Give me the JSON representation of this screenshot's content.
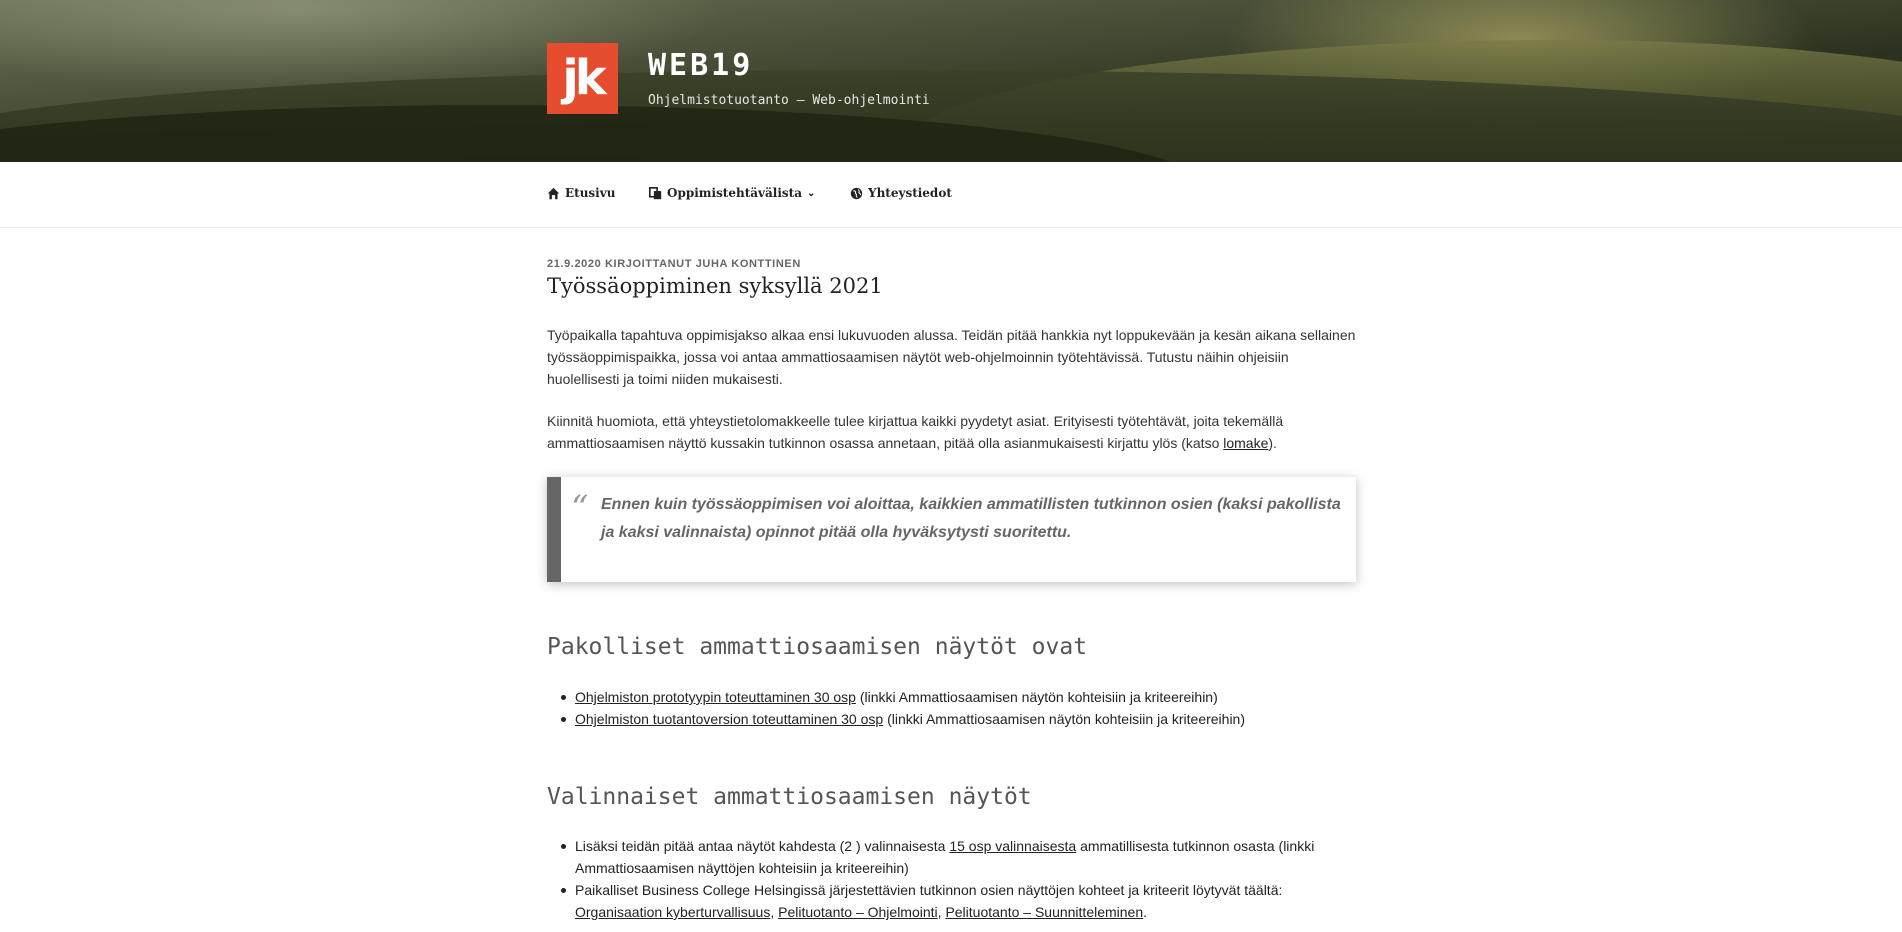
{
  "header": {
    "logo_text": "jk",
    "site_title": "WEB19",
    "site_description": "Ohjelmistotuotanto – Web-ohjelmointi"
  },
  "nav": {
    "items": [
      {
        "label": "Etusivu",
        "icon": "home-icon"
      },
      {
        "label": "Oppimistehtävälista",
        "icon": "copy-icon",
        "has_submenu": true
      },
      {
        "label": "Yhteystiedot",
        "icon": "globe-icon"
      }
    ]
  },
  "post": {
    "meta_date": "21.9.2020",
    "meta_by": "KIRJOITTANUT",
    "meta_author": "JUHA KONTTINEN",
    "title": "Työssäoppiminen syksyllä 2021",
    "para1": "Työpaikalla tapahtuva oppimisjakso alkaa ensi lukuvuoden alussa. Teidän pitää hankkia nyt loppukevään ja kesän aikana sellainen työssäoppimispaikka, jossa voi antaa ammattiosaamisen näytöt web-ohjelmoinnin työtehtävissä. Tutustu näihin ohjeisiin huolellisesti ja toimi niiden mukaisesti.",
    "para2_before": "Kiinnitä huomiota, että yhteystietolomakkeelle tulee kirjattua kaikki pyydetyt asiat. Erityisesti työtehtävät, joita tekemällä ammattiosaamisen näyttö kussakin tutkinnon osassa annetaan, pitää olla asianmukaisesti kirjattu ylös (katso ",
    "para2_link": "lomake",
    "para2_after": ").",
    "quote": "Ennen kuin työssäoppimisen voi aloittaa, kaikkien ammatillisten tutkinnon osien (kaksi pakollista ja kaksi valinnaista) opinnot pitää olla hyväksytysti suoritettu.",
    "section1": {
      "heading": "Pakolliset ammattiosaamisen näytöt ovat",
      "items": [
        {
          "link": "Ohjelmiston prototyypin toteuttaminen 30 osp",
          "text": " (linkki Ammattiosaamisen näytön kohteisiin ja kriteereihin)"
        },
        {
          "link": "Ohjelmiston tuotantoversion toteuttaminen 30 osp",
          "text": " (linkki Ammattiosaamisen näytön kohteisiin ja kriteereihin)"
        }
      ]
    },
    "section2": {
      "heading": "Valinnaiset ammattiosaamisen näytöt",
      "item1_before": "Lisäksi teidän pitää antaa näytöt kahdesta (2 ) valinnaisesta ",
      "item1_link": "15 osp valinnaisesta",
      "item1_after": " ammatillisesta tutkinnon osasta (linkki Ammattiosaamisen näyttöjen kohteisiin ja kriteereihin)",
      "item2_before": "Paikalliset Business College Helsingissä järjestettävien tutkinnon osien näyttöjen kohteet ja kriteerit löytyvät täältä: ",
      "item2_link1": "Organisaation kyberturvallisuus",
      "item2_sep1": ", ",
      "item2_link2": "Pelituotanto – Ohjelmointi",
      "item2_sep2": ", ",
      "item2_link3": "Pelituotanto – Suunnitteleminen",
      "item2_end": "."
    }
  },
  "colors": {
    "logo_bg": "#e54d2e",
    "quote_border": "#666666"
  }
}
